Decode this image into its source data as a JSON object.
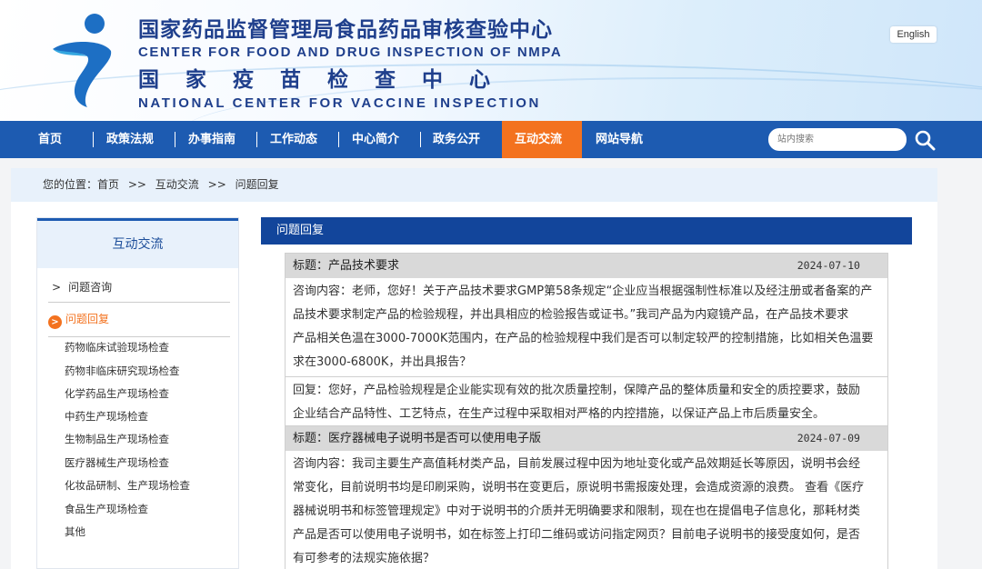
{
  "header": {
    "title_cn": "国家药品监督管理局食品药品审核查验中心",
    "title_en": "CENTER FOR FOOD AND DRUG INSPECTION OF NMPA",
    "subtitle_cn": "国家疫苗检查中心",
    "subtitle_en": "NATIONAL CENTER FOR VACCINE INSPECTION",
    "lang_button": "English"
  },
  "nav": {
    "items": [
      "首页",
      "政策法规",
      "办事指南",
      "工作动态",
      "中心简介",
      "政务公开",
      "互动交流",
      "网站导航"
    ],
    "active": "互动交流",
    "search_placeholder": "站内搜索"
  },
  "breadcrumb": {
    "prefix": "您的位置：",
    "items": [
      "首页",
      "互动交流",
      "问题回复"
    ],
    "separator": ">>"
  },
  "sidebar": {
    "title": "互动交流",
    "items": [
      {
        "label": "问题咨询",
        "marker": ">"
      },
      {
        "label": "问题回复",
        "marker": ">"
      }
    ],
    "sub_items": [
      "药物临床试验现场检查",
      "药物非临床研究现场检查",
      "化学药品生产现场检查",
      "中药生产现场检查",
      "生物制品生产现场检查",
      "医疗器械生产现场检查",
      "化妆品研制、生产现场检查",
      "食品生产现场检查",
      "其他"
    ]
  },
  "main": {
    "section_title": "问题回复",
    "entries": [
      {
        "title_label": "标题：",
        "title": "产品技术要求",
        "date": "2024-07-10",
        "question_lines": [
          "咨询内容：老师，您好！关于产品技术要求GMP第58条规定“企业应当根据强制性标准以及经注册或者备案的产",
          "品技术要求制定产品的检验规程，并出具相应的检验报告或证书。”我司产品为内窥镜产品，在产品技术要求",
          "产品相关色温在3000-7000K范围内，在产品的检验规程中我们是否可以制定较严的控制措施，比如相关色温要",
          "求在3000-6800K，并出具报告？"
        ],
        "reply_lines": [
          "回复：您好，产品检验规程是企业能实现有效的批次质量控制，保障产品的整体质量和安全的质控要求，鼓励",
          "企业结合产品特性、工艺特点，在生产过程中采取相对严格的内控措施，以保证产品上市后质量安全。"
        ]
      },
      {
        "title_label": "标题：",
        "title": "医疗器械电子说明书是否可以使用电子版",
        "date": "2024-07-09",
        "question_lines": [
          "咨询内容：我司主要生产高值耗材类产品，目前发展过程中因为地址变化或产品效期延长等原因，说明书会经",
          "常变化，目前说明书均是印刷采购，说明书在变更后，原说明书需报废处理，会造成资源的浪费。 查看《医疗",
          "器械说明书和标签管理规定》中对于说明书的介质并无明确要求和限制，现在也在提倡电子信息化，那耗材类",
          "产品是否可以使用电子说明书，如在标签上打印二维码或访问指定网页？目前电子说明书的接受度如何，是否",
          "有可参考的法规实施依据？"
        ]
      }
    ]
  },
  "colors": {
    "nav_bg": "#1d5bb1",
    "nav_active": "#f3721f",
    "panel_head": "#12459b",
    "brand_text": "#1f3f8c"
  }
}
